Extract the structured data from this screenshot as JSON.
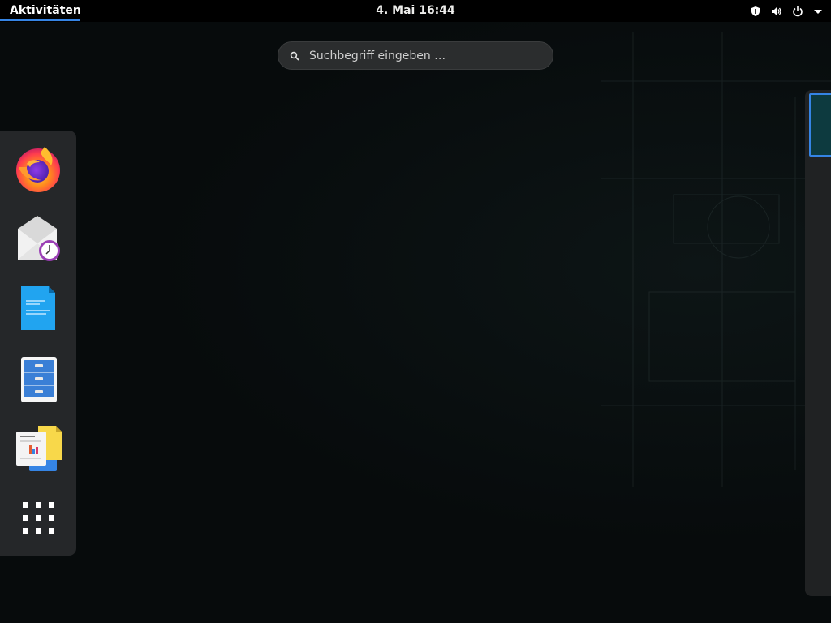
{
  "topbar": {
    "activities_label": "Aktivitäten",
    "clock": "4. Mai  16:44",
    "tray_icons": [
      "shield-icon",
      "volume-icon",
      "power-icon",
      "menu-arrow-icon"
    ]
  },
  "search": {
    "placeholder": "Suchbegriff eingeben …"
  },
  "dash": {
    "apps": [
      {
        "name": "Firefox",
        "icon": "firefox-icon"
      },
      {
        "name": "Evolution",
        "icon": "mail-clock-icon"
      },
      {
        "name": "LibreOffice Writer",
        "icon": "writer-document-icon"
      },
      {
        "name": "Dateien",
        "icon": "file-cabinet-icon"
      },
      {
        "name": "Dokumente",
        "icon": "documents-icon"
      },
      {
        "name": "Anwendungen anzeigen",
        "icon": "app-grid-icon"
      }
    ]
  },
  "colors": {
    "accent": "#3584e4",
    "topbar_bg": "#000000",
    "dash_bg": "#252729",
    "search_bg": "#2b2d2e",
    "workspace_thumb": "#0d3a3f"
  }
}
